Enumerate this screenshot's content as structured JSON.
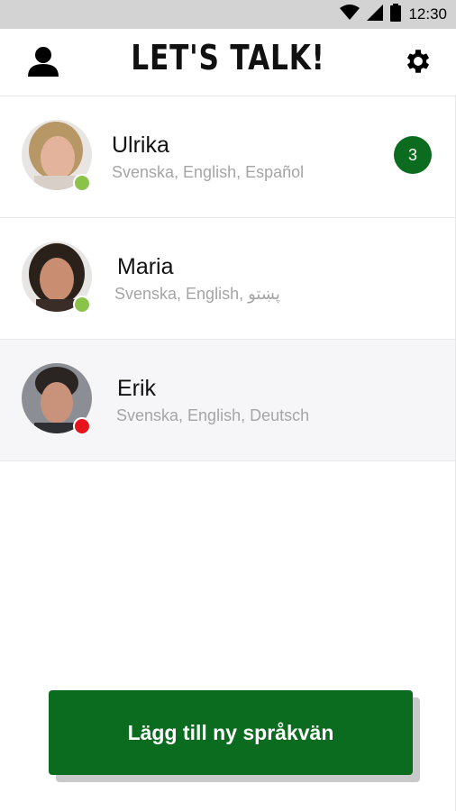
{
  "status_bar": {
    "time": "12:30",
    "icons": [
      "wifi-icon",
      "cell-signal-icon",
      "battery-icon"
    ]
  },
  "header": {
    "title": "LET'S TALK!",
    "left_icon": "profile-icon",
    "right_icon": "gear-icon"
  },
  "contacts": [
    {
      "name": "Ulrika",
      "languages": "Svenska, English, Español",
      "status": "online",
      "status_color": "#8bc34a",
      "unread": "3",
      "selected": false
    },
    {
      "name": "Maria",
      "languages": "Svenska, English, پښتو",
      "status": "online",
      "status_color": "#8bc34a",
      "unread": "",
      "selected": false
    },
    {
      "name": "Erik",
      "languages": "Svenska, English, Deutsch",
      "status": "offline",
      "status_color": "#e8141c",
      "unread": "",
      "selected": true
    }
  ],
  "add_button": {
    "label": "Lägg till ny språkvän"
  },
  "colors": {
    "primary_green": "#0b6b1f",
    "status_bar": "#d3d3d3",
    "secondary_text": "#a5a5a5"
  }
}
